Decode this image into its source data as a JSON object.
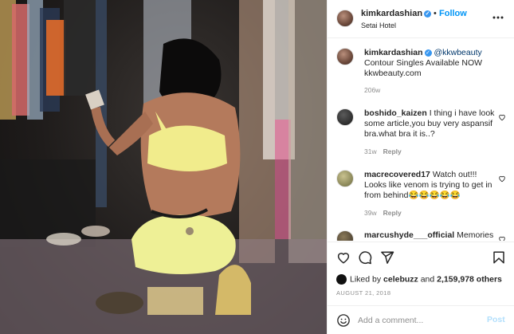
{
  "post": {
    "username": "kimkardashian",
    "follow_label": "Follow",
    "dot": "•",
    "location": "Setai Hotel",
    "verified_mark": "✓"
  },
  "caption": {
    "username": "kimkardashian",
    "mention": "@kkwbeauty",
    "line1": "Contour Singles Available NOW",
    "line2": "kkwbeauty.com",
    "time": "206w"
  },
  "comments": [
    {
      "username": "boshido_kaizen",
      "text": "I thing i have look some article,you buy very aspansif bra.what bra it is..?",
      "time": "31w",
      "reply_label": "Reply"
    },
    {
      "username": "macrecovered17",
      "text": "Watch out!!! Looks like venom is trying to get in from behind😂😂😂😂😂",
      "time": "39w",
      "reply_label": "Reply"
    },
    {
      "username": "marcushyde___official",
      "text": "Memories",
      "time": "",
      "reply_label": ""
    }
  ],
  "likes": {
    "prefix": "Liked by",
    "user": "celebuzz",
    "and": "and",
    "count": "2,159,978 others"
  },
  "date": "AUGUST 21, 2018",
  "add_comment": {
    "placeholder": "Add a comment...",
    "post_label": "Post"
  },
  "icons": {
    "more": "more-options-icon",
    "like": "heart-icon",
    "comment": "comment-icon",
    "share": "send-icon",
    "save": "bookmark-icon",
    "emoji": "emoji-icon"
  },
  "colors": {
    "accent": "#0095f6",
    "verified": "#3897f0",
    "post_disabled": "#b2dffc",
    "muted": "#8e8e8e"
  }
}
